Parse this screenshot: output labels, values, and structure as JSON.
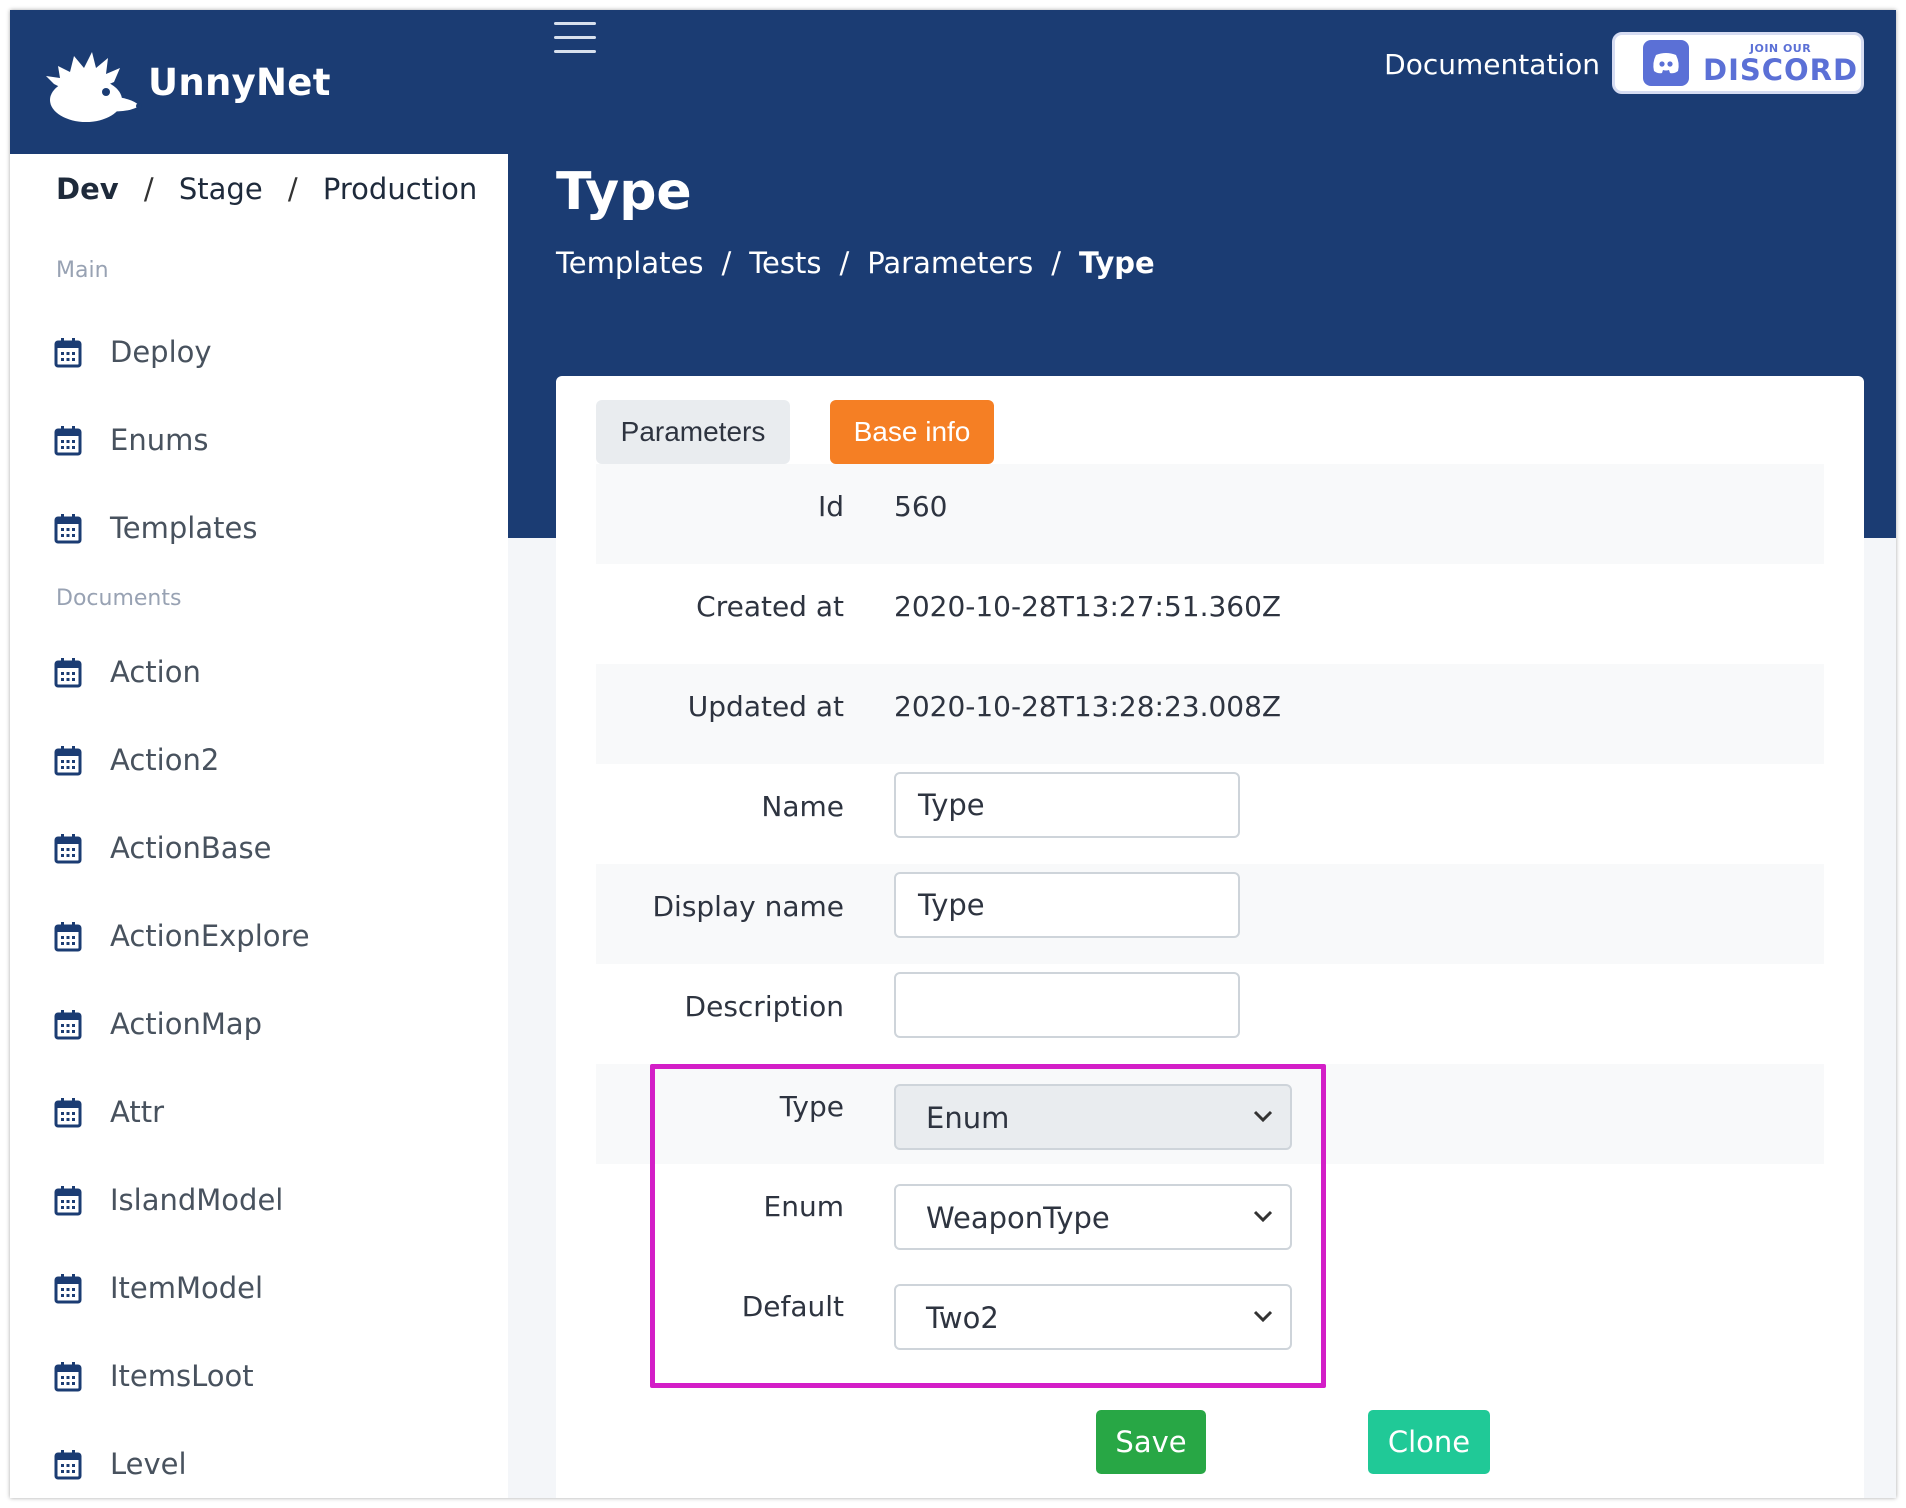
{
  "brand": {
    "name": "UnnyNet"
  },
  "environments": {
    "dev": "Dev",
    "stage": "Stage",
    "production": "Production",
    "separator": "/"
  },
  "sidebar": {
    "sections": [
      {
        "title": "Main",
        "items": [
          {
            "label": "Deploy"
          },
          {
            "label": "Enums"
          },
          {
            "label": "Templates"
          }
        ]
      },
      {
        "title": "Documents",
        "items": [
          {
            "label": "Action"
          },
          {
            "label": "Action2"
          },
          {
            "label": "ActionBase"
          },
          {
            "label": "ActionExplore"
          },
          {
            "label": "ActionMap"
          },
          {
            "label": "Attr"
          },
          {
            "label": "IslandModel"
          },
          {
            "label": "ItemModel"
          },
          {
            "label": "ItemsLoot"
          },
          {
            "label": "Level"
          }
        ]
      }
    ],
    "item_icon": "calendar-icon"
  },
  "header": {
    "documentation_label": "Documentation",
    "discord": {
      "small": "JOIN OUR",
      "big": "DISCORD"
    },
    "menu_icon": "hamburger-icon"
  },
  "page": {
    "title": "Type",
    "breadcrumb": [
      "Templates",
      "Tests",
      "Parameters",
      "Type"
    ],
    "breadcrumb_separator": "/"
  },
  "tabs": [
    {
      "label": "Parameters",
      "active": false
    },
    {
      "label": "Base info",
      "active": true
    }
  ],
  "fields": {
    "id": {
      "label": "Id",
      "value": "560"
    },
    "created_at": {
      "label": "Created at",
      "value": "2020-10-28T13:27:51.360Z"
    },
    "updated_at": {
      "label": "Updated at",
      "value": "2020-10-28T13:28:23.008Z"
    },
    "name": {
      "label": "Name",
      "value": "Type"
    },
    "display_name": {
      "label": "Display name",
      "value": "Type"
    },
    "description": {
      "label": "Description",
      "value": ""
    },
    "type": {
      "label": "Type",
      "value": "Enum"
    },
    "enum": {
      "label": "Enum",
      "value": "WeaponType"
    },
    "default": {
      "label": "Default",
      "value": "Two2"
    }
  },
  "actions": {
    "save": "Save",
    "clone": "Clone"
  },
  "colors": {
    "header_bg": "#1b3c73",
    "active_tab": "#f57f24",
    "save": "#28a745",
    "clone": "#20c997",
    "highlight": "#d31ec7",
    "discord": "#5b70d6"
  }
}
